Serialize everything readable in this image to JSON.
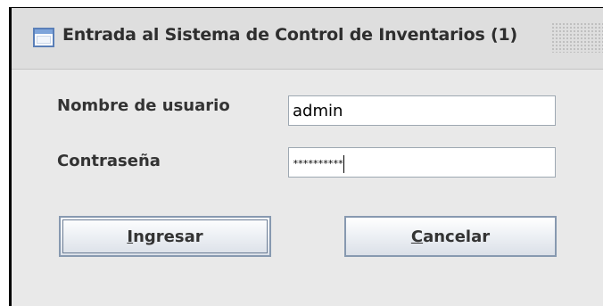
{
  "window": {
    "title": "Entrada al Sistema de Control de Inventarios (1)"
  },
  "form": {
    "username_label": "Nombre de usuario",
    "username_value": "admin",
    "password_label": "Contraseña",
    "password_value": "**********"
  },
  "buttons": {
    "ingresar_mnemonic": "I",
    "ingresar_rest": "ngresar",
    "cancelar_mnemonic": "C",
    "cancelar_rest": "ancelar"
  },
  "icons": {
    "window_icon": "application-window-icon"
  },
  "colors": {
    "background": "#e9e9e9",
    "titlebar": "#dedede",
    "button_border": "#8799b0",
    "field_border": "#9ea8b2"
  }
}
